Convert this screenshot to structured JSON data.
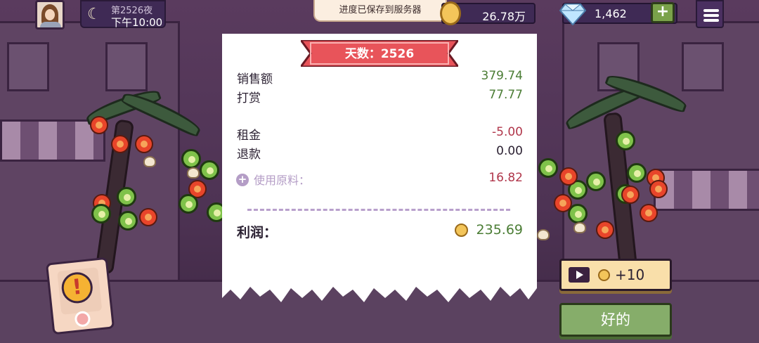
{
  "header": {
    "day": "第2526夜",
    "time": "下午10:00",
    "toast": "进度已保存到服务器",
    "coins": "26.78万",
    "gems": "1,462",
    "plus": "+"
  },
  "receipt": {
    "title": "天数：2526",
    "sales_label": "销售额",
    "sales_value": "379.74",
    "tips_label": "打赏",
    "tips_value": "77.77",
    "rent_label": "租金",
    "rent_value": "-5.00",
    "refund_label": "退款",
    "refund_value": "0.00",
    "ingredients_label": "使用原料：",
    "ingredients_value": "16.82",
    "profit_label": "利润：",
    "profit_value": "235.69"
  },
  "buttons": {
    "ad_reward": "+10",
    "ok": "好的"
  },
  "alert": {
    "symbol": "!"
  },
  "colors": {
    "income": "#4b7d35",
    "expense": "#b0364a",
    "ribbon": "#e8545a"
  }
}
